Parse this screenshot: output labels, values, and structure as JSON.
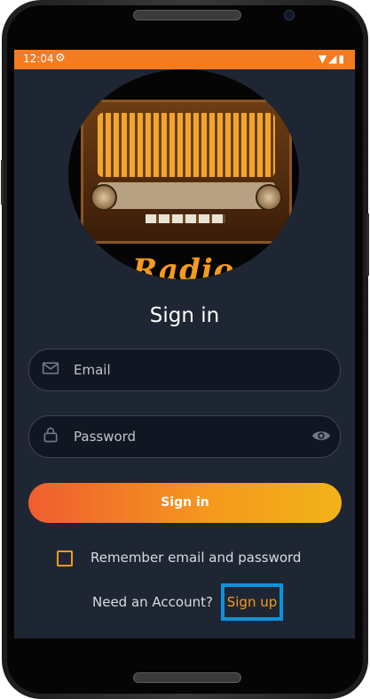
{
  "status_bar": {
    "time": "12:04",
    "icons": [
      "settings-icon",
      "wifi-icon",
      "signal-icon",
      "battery-icon"
    ]
  },
  "logo": {
    "text": "Radio Journey"
  },
  "title": "Sign in",
  "email": {
    "placeholder": "Email",
    "value": ""
  },
  "password": {
    "placeholder": "Password",
    "value": ""
  },
  "sign_in_button": {
    "label": "Sign in"
  },
  "remember": {
    "label": "Remember email and password",
    "checked": false
  },
  "account": {
    "prompt": "Need an Account?",
    "link": "Sign up"
  },
  "colors": {
    "accent": "#f59b1c",
    "status_bar": "#f47b20",
    "background": "#1f2633",
    "highlight": "#0a93e0"
  }
}
